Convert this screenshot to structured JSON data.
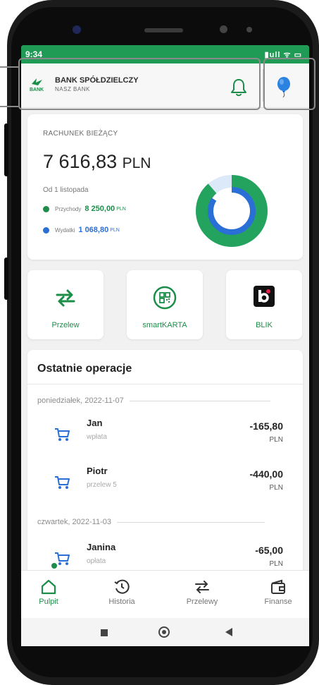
{
  "status_bar": {
    "time": "9:34",
    "icons": "▮ull ᯤ ▭"
  },
  "header": {
    "bank_name": "BANK SPÓŁDZIELCZY",
    "bank_subtitle": "NASZ BANK",
    "logo_text": "BANK",
    "icons": [
      "bell-icon",
      "balloon-icon"
    ]
  },
  "account": {
    "title": "RACHUNEK BIEŻĄCY",
    "balance": "7 616,83",
    "currency": "PLN",
    "period": "Od 1 listopada",
    "income_label": "Przychody",
    "income_value": "8 250,00",
    "income_currency": "PLN",
    "expense_label": "Wydatki",
    "expense_value": "1 068,80",
    "expense_currency": "PLN",
    "income_color": "#1c8e4a",
    "expense_color": "#2a6fd6",
    "income_share": 0.885
  },
  "tiles": [
    {
      "label": "Przelew",
      "icon": "transfer-icon"
    },
    {
      "label": "smartKARTA",
      "icon": "qr-card-icon"
    },
    {
      "label": "BLIK",
      "icon": "blik-icon"
    }
  ],
  "operations": {
    "title": "Ostatnie operacje",
    "groups": [
      {
        "date": "poniedziałek, 2022-11-07",
        "items": [
          {
            "name": "Jan",
            "desc": "wpłata",
            "amount": "-165,80",
            "currency": "PLN"
          },
          {
            "name": "Piotr",
            "desc": "przelew 5",
            "amount": "-440,00",
            "currency": "PLN"
          }
        ]
      },
      {
        "date": "czwartek, 2022-11-03",
        "items": [
          {
            "name": "Janina",
            "desc": "opłata",
            "amount": "-65,00",
            "currency": "PLN"
          }
        ]
      }
    ]
  },
  "bottom_nav": [
    {
      "label": "Pulpit",
      "icon": "home-icon",
      "active": true
    },
    {
      "label": "Historia",
      "icon": "history-icon",
      "active": false
    },
    {
      "label": "Przelewy",
      "icon": "transfers-icon",
      "active": false
    },
    {
      "label": "Finanse",
      "icon": "finance-icon",
      "active": false
    }
  ],
  "colors": {
    "brand_green": "#1c8e4a",
    "status_bar": "#1f9b55"
  }
}
